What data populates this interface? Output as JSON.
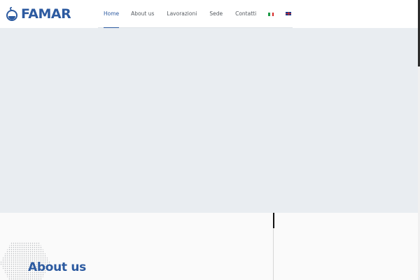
{
  "brand": {
    "name": "FAMAR",
    "logo_icon": "flask-icon",
    "color": "#2c5aa0"
  },
  "nav": {
    "items": [
      {
        "label": "Home",
        "active": true
      },
      {
        "label": "About us",
        "active": false
      },
      {
        "label": "Lavorazioni",
        "active": false
      },
      {
        "label": "Sede",
        "active": false
      },
      {
        "label": "Contatti",
        "active": false
      }
    ],
    "languages": [
      {
        "icon": "flag-it-icon"
      },
      {
        "icon": "flag-uk-icon"
      }
    ]
  },
  "hero": {
    "background": "#e9edf1"
  },
  "about": {
    "title": "About us"
  }
}
